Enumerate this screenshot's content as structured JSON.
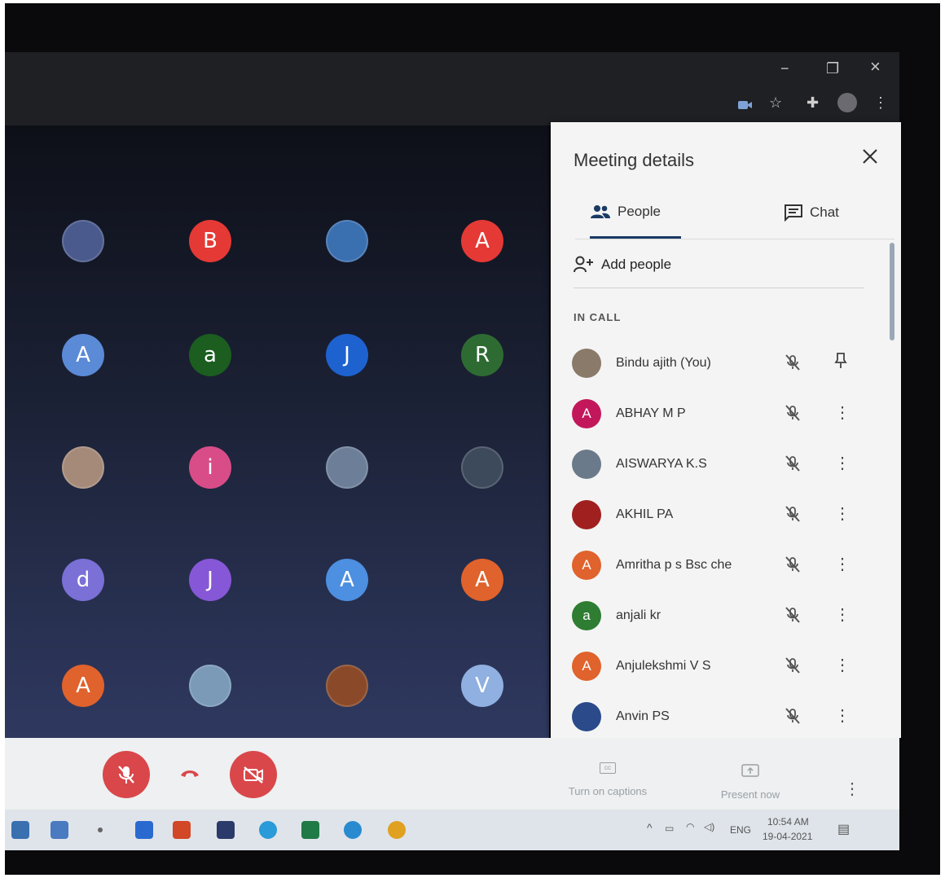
{
  "window": {
    "minimize": "−",
    "restore": "❐",
    "close": "×"
  },
  "toolbar": {
    "icons": [
      "camera-icon",
      "star-icon",
      "extensions-icon",
      "profile-avatar",
      "more-vert-icon"
    ]
  },
  "grid": {
    "tiles": [
      {
        "letter": "",
        "color": "#4a5a8c"
      },
      {
        "letter": "B",
        "color": "#e53935"
      },
      {
        "letter": "",
        "color": "#3a6fb0"
      },
      {
        "letter": "A",
        "color": "#e53935"
      },
      {
        "letter": "A",
        "color": "#5b8ad6"
      },
      {
        "letter": "a",
        "color": "#1b5e20"
      },
      {
        "letter": "J",
        "color": "#1e62d0"
      },
      {
        "letter": "R",
        "color": "#2e6b32"
      },
      {
        "letter": "",
        "color": "#a58a7a"
      },
      {
        "letter": "i",
        "color": "#d84d88"
      },
      {
        "letter": "",
        "color": "#6d7f98"
      },
      {
        "letter": "",
        "color": "#3d4a5c"
      },
      {
        "letter": "d",
        "color": "#7a70d6"
      },
      {
        "letter": "J",
        "color": "#8657d6"
      },
      {
        "letter": "A",
        "color": "#4d8fe0"
      },
      {
        "letter": "A",
        "color": "#e0622c"
      },
      {
        "letter": "A",
        "color": "#e0622c"
      },
      {
        "letter": "",
        "color": "#7a9ab8"
      },
      {
        "letter": "",
        "color": "#8a4a2a"
      },
      {
        "letter": "V",
        "color": "#8fb0e0"
      }
    ]
  },
  "panel": {
    "title": "Meeting details",
    "tabs": {
      "people": "People",
      "chat": "Chat"
    },
    "add_people": "Add people",
    "section": "IN CALL",
    "participants": [
      {
        "name": "Bindu ajith (You)",
        "letter": "",
        "color": "#8a7a6a",
        "action": "pin"
      },
      {
        "name": "ABHAY M P",
        "letter": "A",
        "color": "#c2185b",
        "action": "more"
      },
      {
        "name": "AISWARYA K.S",
        "letter": "",
        "color": "#6a7a8a",
        "action": "more"
      },
      {
        "name": "AKHIL PA",
        "letter": "",
        "color": "#a02020",
        "action": "more"
      },
      {
        "name": "Amritha p s Bsc che",
        "letter": "A",
        "color": "#e0622c",
        "action": "more"
      },
      {
        "name": "anjali kr",
        "letter": "a",
        "color": "#2e7d32",
        "action": "more"
      },
      {
        "name": "Anjulekshmi V S",
        "letter": "A",
        "color": "#e0622c",
        "action": "more"
      },
      {
        "name": "Anvin PS",
        "letter": "",
        "color": "#2a4a8a",
        "action": "more"
      }
    ]
  },
  "bottom": {
    "captions_label": "Turn on captions",
    "present_label": "Present now",
    "cc_text": "cc"
  },
  "taskbar": {
    "time": "10:54 AM",
    "date": "19-04-2021",
    "language": "ENG",
    "app_icons": [
      {
        "name": "mail-icon",
        "color": "#3a6fb0"
      },
      {
        "name": "network-drive-icon",
        "color": "#4a7ac0"
      },
      {
        "name": "dot-icon",
        "color": "#666"
      },
      {
        "name": "app-s-icon",
        "color": "#2a6ad0"
      },
      {
        "name": "powerpoint-icon",
        "color": "#d24726"
      },
      {
        "name": "dropbox-icon",
        "color": "#2a3a6a"
      },
      {
        "name": "telegram-icon",
        "color": "#2a9ad8"
      },
      {
        "name": "excel-icon",
        "color": "#1f7a45"
      },
      {
        "name": "edge-icon",
        "color": "#2a8ad0"
      },
      {
        "name": "chrome-icon",
        "color": "#e0a020"
      }
    ]
  }
}
